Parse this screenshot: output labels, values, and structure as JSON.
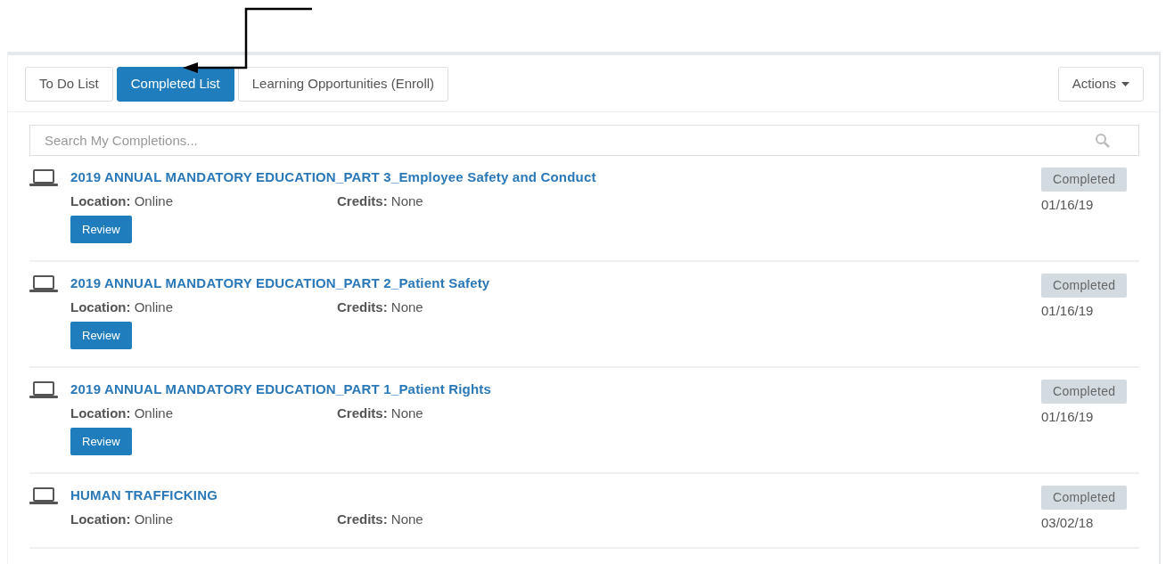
{
  "tabs": [
    {
      "label": "To Do List",
      "selected": false
    },
    {
      "label": "Completed List",
      "selected": true
    },
    {
      "label": "Learning Opportunities (Enroll)",
      "selected": false
    }
  ],
  "actions_menu": {
    "label": "Actions"
  },
  "search": {
    "placeholder": "Search My Completions..."
  },
  "courses": [
    {
      "title": "2019 ANNUAL MANDATORY EDUCATION_PART 3_Employee Safety and Conduct",
      "location": "**Location:** Online",
      "credits": "**Credits:** None",
      "button": "Review",
      "status": "Completed",
      "date": "01/16/19"
    },
    {
      "title": "2019 ANNUAL MANDATORY EDUCATION_PART 2_Patient Safety",
      "location": "**Location:** Online",
      "credits": "**Credits:** None",
      "button": "Review",
      "status": "Completed",
      "date": "01/16/19"
    },
    {
      "title": "2019 ANNUAL MANDATORY EDUCATION_PART 1_Patient Rights",
      "location": "**Location:** Online",
      "credits": "**Credits:** None",
      "button": "Review",
      "status": "Completed",
      "date": "01/16/19"
    },
    {
      "title": "HUMAN TRAFFICKING",
      "location": "**Location:** Online",
      "credits": "**Credits:** None",
      "status": "Completed",
      "date": "03/02/18"
    }
  ]
}
